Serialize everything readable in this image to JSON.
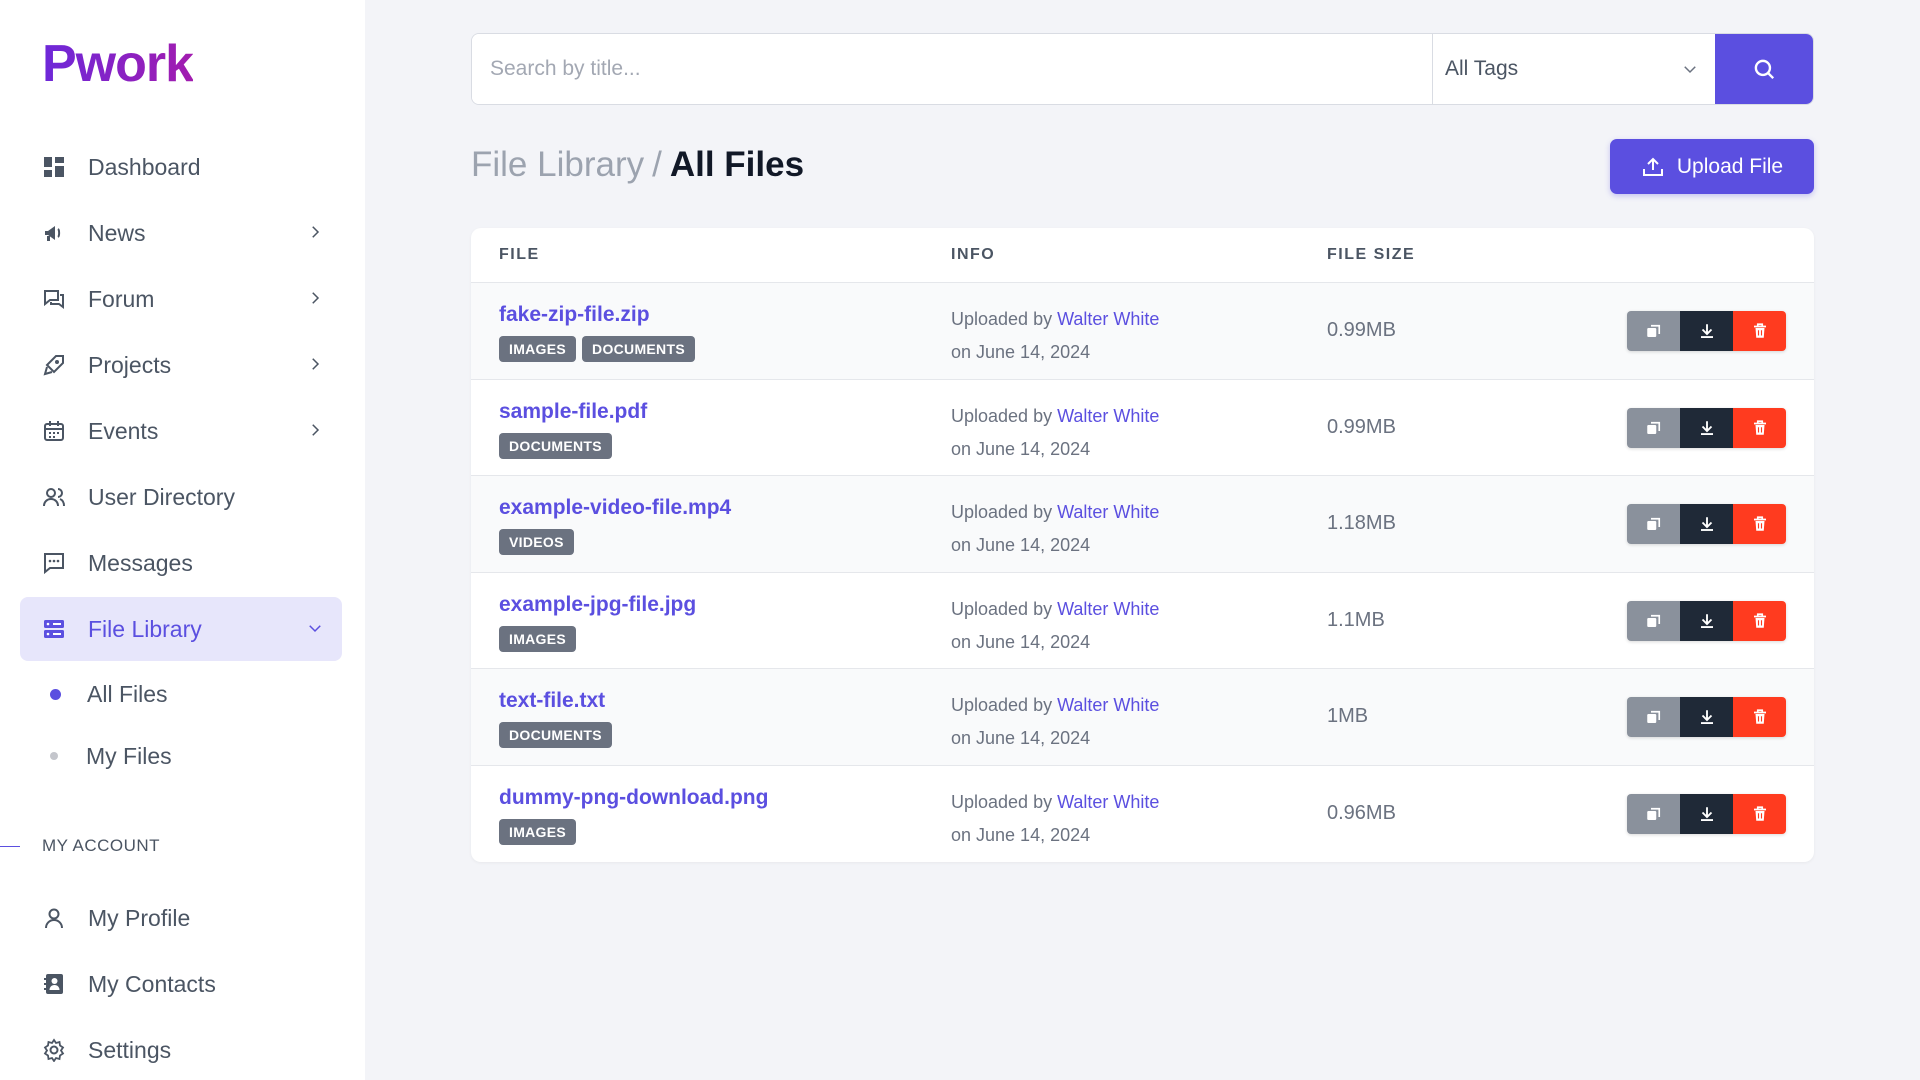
{
  "app": {
    "logo": "Pwork"
  },
  "sidebar": {
    "items": [
      {
        "label": "Dashboard",
        "icon": "dashboard-icon"
      },
      {
        "label": "News",
        "icon": "megaphone-icon"
      },
      {
        "label": "Forum",
        "icon": "chat-bubbles-icon"
      },
      {
        "label": "Projects",
        "icon": "rocket-icon"
      },
      {
        "label": "Events",
        "icon": "calendar-icon"
      },
      {
        "label": "User Directory",
        "icon": "users-icon"
      },
      {
        "label": "Messages",
        "icon": "message-icon"
      },
      {
        "label": "File Library",
        "icon": "server-icon",
        "active": true
      }
    ],
    "sub_items": [
      {
        "label": "All Files",
        "active": true
      },
      {
        "label": "My Files",
        "active": false
      }
    ],
    "section_label": "MY ACCOUNT",
    "account_items": [
      {
        "label": "My Profile",
        "icon": "user-icon"
      },
      {
        "label": "My Contacts",
        "icon": "contacts-icon"
      },
      {
        "label": "Settings",
        "icon": "gear-icon"
      }
    ]
  },
  "search": {
    "placeholder": "Search by title...",
    "tag_filter": "All Tags"
  },
  "breadcrumb": {
    "parent": "File Library",
    "separator": "/",
    "current": "All Files"
  },
  "upload_label": "Upload File",
  "table": {
    "headers": {
      "file": "FILE",
      "info": "INFO",
      "size": "FILE SIZE"
    },
    "rows": [
      {
        "name": "fake-zip-file.zip",
        "tags": [
          "IMAGES",
          "DOCUMENTS"
        ],
        "uploaded_prefix": "Uploaded by",
        "uploader": "Walter White",
        "date": "on June 14, 2024",
        "size": "0.99MB"
      },
      {
        "name": "sample-file.pdf",
        "tags": [
          "DOCUMENTS"
        ],
        "uploaded_prefix": "Uploaded by",
        "uploader": "Walter White",
        "date": "on June 14, 2024",
        "size": "0.99MB"
      },
      {
        "name": "example-video-file.mp4",
        "tags": [
          "VIDEOS"
        ],
        "uploaded_prefix": "Uploaded by",
        "uploader": "Walter White",
        "date": "on June 14, 2024",
        "size": "1.18MB"
      },
      {
        "name": "example-jpg-file.jpg",
        "tags": [
          "IMAGES"
        ],
        "uploaded_prefix": "Uploaded by",
        "uploader": "Walter White",
        "date": "on June 14, 2024",
        "size": "1.1MB"
      },
      {
        "name": "text-file.txt",
        "tags": [
          "DOCUMENTS"
        ],
        "uploaded_prefix": "Uploaded by",
        "uploader": "Walter White",
        "date": "on June 14, 2024",
        "size": "1MB"
      },
      {
        "name": "dummy-png-download.png",
        "tags": [
          "IMAGES"
        ],
        "uploaded_prefix": "Uploaded by",
        "uploader": "Walter White",
        "date": "on June 14, 2024",
        "size": "0.96MB"
      }
    ]
  },
  "colors": {
    "accent": "#5b4fe0",
    "delete": "#ff3b1f",
    "download": "#1f2937",
    "copy": "#8a919c"
  }
}
